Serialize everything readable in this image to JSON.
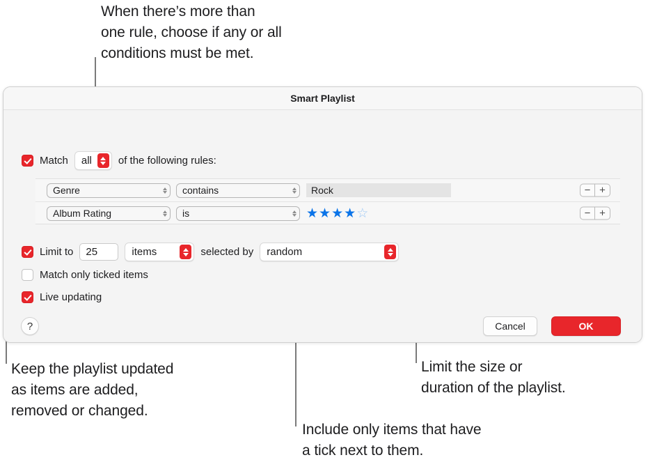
{
  "callouts": {
    "top": "When there’s more than\none rule, choose if any or all\nconditions must be met.",
    "left": "Keep the playlist updated\nas items are added,\nremoved or changed.",
    "middle": "Include only items that have\na tick next to them.",
    "right": "Limit the size or\nduration of the playlist."
  },
  "dialog": {
    "title": "Smart Playlist",
    "match": {
      "checked": true,
      "label_before": "Match",
      "popup_value": "all",
      "label_after": "of the following rules:"
    },
    "rules": [
      {
        "field": "Genre",
        "operator": "contains",
        "value_type": "text",
        "value": "Rock",
        "remove_label": "−",
        "add_label": "+"
      },
      {
        "field": "Album Rating",
        "operator": "is",
        "value_type": "rating",
        "rating_filled": 4,
        "rating_total": 5,
        "remove_label": "−",
        "add_label": "+"
      }
    ],
    "limit": {
      "checked": true,
      "label": "Limit to",
      "amount": "25",
      "unit": "items",
      "selected_by_label": "selected by",
      "selected_by_value": "random"
    },
    "match_ticked": {
      "checked": false,
      "label": "Match only ticked items"
    },
    "live_updating": {
      "checked": true,
      "label": "Live updating"
    },
    "buttons": {
      "help": "?",
      "cancel": "Cancel",
      "ok": "OK"
    }
  },
  "colors": {
    "accent_red": "#e8262b",
    "star_blue": "#0b74e8",
    "star_empty": "#9dc8f5",
    "leader_gray": "#7a7a7a"
  }
}
